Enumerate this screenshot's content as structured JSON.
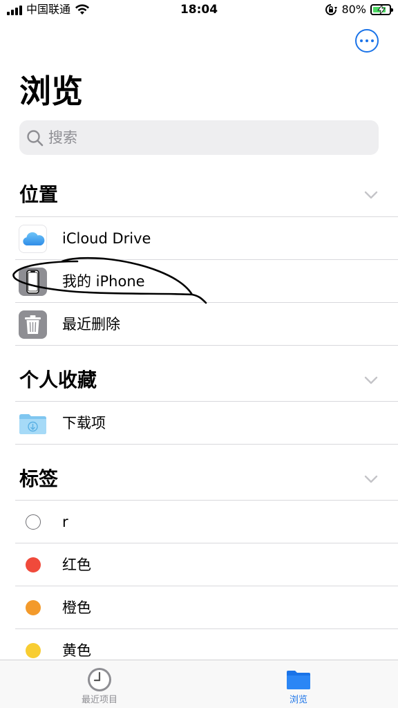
{
  "status_bar": {
    "carrier": "中国联通",
    "time": "18:04",
    "battery_percent": "80%",
    "battery_level": 0.8
  },
  "header": {
    "title": "浏览",
    "more_icon": "ellipsis-circle-icon"
  },
  "search": {
    "placeholder": "搜索"
  },
  "sections": {
    "locations": {
      "title": "位置",
      "items": [
        {
          "label": "iCloud Drive",
          "icon": "icloud-icon"
        },
        {
          "label": "我的 iPhone",
          "icon": "iphone-icon"
        },
        {
          "label": "最近删除",
          "icon": "trash-icon"
        }
      ]
    },
    "favorites": {
      "title": "个人收藏",
      "items": [
        {
          "label": "下载项",
          "icon": "downloads-folder-icon"
        }
      ]
    },
    "tags": {
      "title": "标签",
      "items": [
        {
          "label": "r",
          "color": ""
        },
        {
          "label": "红色",
          "color": "#f04a3b"
        },
        {
          "label": "橙色",
          "color": "#f39a2b"
        },
        {
          "label": "黄色",
          "color": "#f8cd32"
        }
      ]
    }
  },
  "tab_bar": {
    "recent_label": "最近项目",
    "browse_label": "浏览",
    "active_color": "#1a73e8"
  }
}
